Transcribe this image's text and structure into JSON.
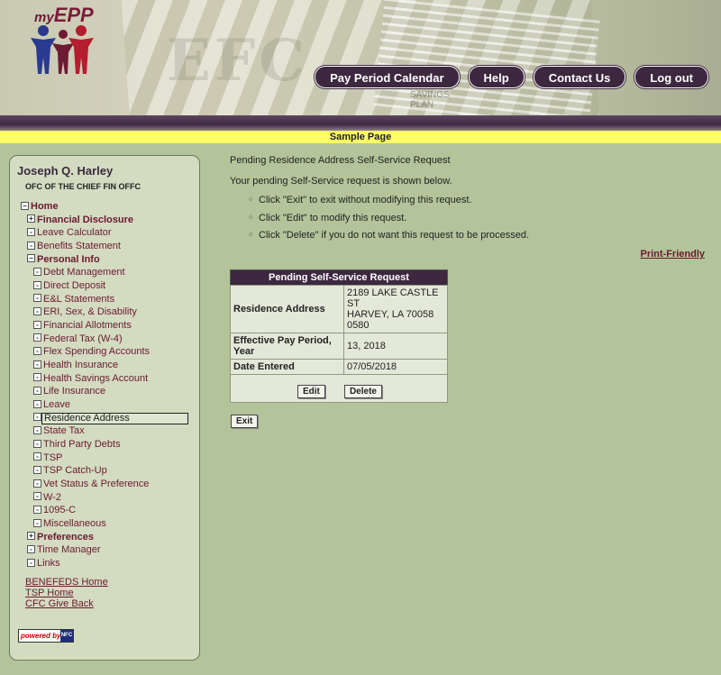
{
  "header": {
    "logo": "myEPP",
    "bg_text": "SAVINGS PLAN",
    "nav": [
      "Pay Period Calendar",
      "Help",
      "Contact Us",
      "Log out"
    ]
  },
  "banner": "Sample Page",
  "sidebar": {
    "user_name": "Joseph Q. Harley",
    "user_org": "OFC OF THE CHIEF FIN OFFC",
    "tree": [
      {
        "label": "Home",
        "box": "−",
        "bold": true,
        "level": 0
      },
      {
        "label": "Financial Disclosure",
        "box": "+",
        "bold": true,
        "level": 1
      },
      {
        "label": "Leave Calculator",
        "box": "-",
        "bold": false,
        "level": 1
      },
      {
        "label": "Benefits Statement",
        "box": "-",
        "bold": false,
        "level": 1
      },
      {
        "label": "Personal Info",
        "box": "−",
        "bold": true,
        "level": 1
      },
      {
        "label": "Debt Management",
        "box": "-",
        "bold": false,
        "level": 2
      },
      {
        "label": "Direct Deposit",
        "box": "-",
        "bold": false,
        "level": 2
      },
      {
        "label": "E&L Statements",
        "box": "-",
        "bold": false,
        "level": 2
      },
      {
        "label": "ERI, Sex, & Disability",
        "box": "-",
        "bold": false,
        "level": 2
      },
      {
        "label": "Financial Allotments",
        "box": "-",
        "bold": false,
        "level": 2
      },
      {
        "label": "Federal Tax (W-4)",
        "box": "-",
        "bold": false,
        "level": 2
      },
      {
        "label": "Flex Spending Accounts",
        "box": "-",
        "bold": false,
        "level": 2
      },
      {
        "label": "Health Insurance",
        "box": "-",
        "bold": false,
        "level": 2
      },
      {
        "label": "Health Savings Account",
        "box": "-",
        "bold": false,
        "level": 2
      },
      {
        "label": "Life Insurance",
        "box": "-",
        "bold": false,
        "level": 2
      },
      {
        "label": "Leave",
        "box": "-",
        "bold": false,
        "level": 2
      },
      {
        "label": "Residence Address",
        "box": "-",
        "bold": false,
        "level": 2,
        "selected": true
      },
      {
        "label": "State Tax",
        "box": "-",
        "bold": false,
        "level": 2
      },
      {
        "label": "Third Party Debts",
        "box": "-",
        "bold": false,
        "level": 2
      },
      {
        "label": "TSP",
        "box": "-",
        "bold": false,
        "level": 2
      },
      {
        "label": "TSP Catch-Up",
        "box": "-",
        "bold": false,
        "level": 2
      },
      {
        "label": "Vet Status & Preference",
        "box": "-",
        "bold": false,
        "level": 2
      },
      {
        "label": "W-2",
        "box": "-",
        "bold": false,
        "level": 2
      },
      {
        "label": "1095-C",
        "box": "-",
        "bold": false,
        "level": 2
      },
      {
        "label": "Miscellaneous",
        "box": "-",
        "bold": false,
        "level": 2
      },
      {
        "label": "Preferences",
        "box": "+",
        "bold": true,
        "level": 1
      },
      {
        "label": "Time Manager",
        "box": "-",
        "bold": false,
        "level": 1
      },
      {
        "label": "Links",
        "box": "-",
        "bold": false,
        "level": 1
      }
    ],
    "links": [
      "BENEFEDS Home",
      "TSP Home",
      "CFC Give Back"
    ],
    "powered_by": "powered by",
    "powered_by_logo": "NFC"
  },
  "main": {
    "title": "Pending Residence Address Self-Service Request",
    "intro": "Your pending Self-Service request is shown below.",
    "bullets": [
      "Click \"Exit\" to exit without modifying this request.",
      "Click \"Edit\" to modify this request.",
      "Click \"Delete\" if you do not want this request to be processed."
    ],
    "print_friendly": "Print-Friendly",
    "table": {
      "header": "Pending Self-Service Request",
      "rows": [
        {
          "label": "Residence Address",
          "value_line1": "2189 LAKE CASTLE ST",
          "value_line2": "HARVEY, LA 70058 0580"
        },
        {
          "label": "Effective Pay Period, Year",
          "value_line1": "13, 2018"
        },
        {
          "label": "Date Entered",
          "value_line1": "07/05/2018"
        }
      ],
      "edit_label": "Edit",
      "delete_label": "Delete"
    },
    "exit_label": "Exit"
  }
}
